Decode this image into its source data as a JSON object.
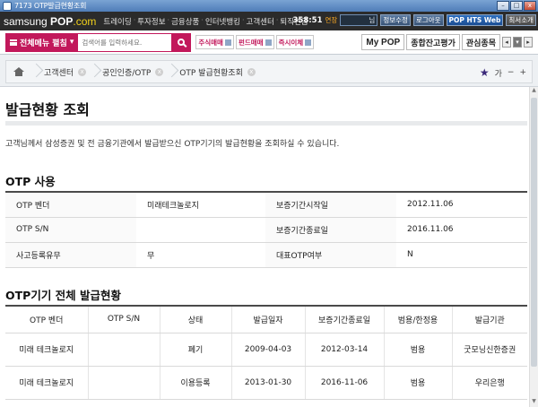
{
  "window": {
    "title": "7173 OTP발급현황조회",
    "min": "–",
    "max": "□",
    "close": "x"
  },
  "nav": {
    "logo_a": "samsung",
    "logo_b": "POP",
    "logo_c": ".com",
    "items": [
      "트레이딩",
      "투자정보",
      "금융상품",
      "인터넷뱅킹",
      "고객센터",
      "퇴직연금"
    ],
    "clock": "358:51",
    "clock_ext": "연장",
    "user_suffix": "님",
    "btn_info": "정보수정",
    "btn_logout": "로그아웃",
    "btn_hts": "POP HTS Web",
    "btn_min": "최서소개"
  },
  "bar2": {
    "allmenu": "전체메뉴 펼침",
    "search_placeholder": "검색어를 입력하세요.",
    "quick": [
      "주식매매",
      "펀드매매",
      "즉시이체"
    ],
    "right_tabs": [
      "My POP",
      "종합잔고평가",
      "관심종목"
    ],
    "mini": [
      "◂",
      "▾",
      "▸"
    ]
  },
  "breadcrumb": {
    "items": [
      "고객센터",
      "공인인증/OTP",
      "OTP 발급현황조회"
    ],
    "close": "x",
    "tools": {
      "star": "★",
      "font": "가",
      "minus": "−",
      "plus": "+"
    }
  },
  "page": {
    "title": "발급현황 조회",
    "description": "고객님께서 삼성증권 및 전 금융기관에서 발급받으신 OTP기기의 발급현황을 조회하실 수 있습니다."
  },
  "otp_use": {
    "heading": "OTP 사용",
    "rows": [
      [
        "OTP 벤더",
        "미래테크놀로지",
        "보증기간시작일",
        "2012.11.06"
      ],
      [
        "OTP S/N",
        "",
        "보증기간종료일",
        "2016.11.06"
      ],
      [
        "사고등록유무",
        "무",
        "대표OTP여부",
        "N"
      ]
    ]
  },
  "otp_all": {
    "heading": "OTP기기 전체 발급현황",
    "columns": [
      "OTP 벤더",
      "OTP S/N",
      "상태",
      "발급일자",
      "보증기간종료일",
      "범용/한정용",
      "발급기관"
    ],
    "rows": [
      [
        "미래 테크놀로지",
        "",
        "폐기",
        "2009-04-03",
        "2012-03-14",
        "범용",
        "굿모닝신한증권"
      ],
      [
        "미래 테크놀로지",
        "",
        "이용등록",
        "2013-01-30",
        "2016-11-06",
        "범용",
        "우리은행"
      ]
    ]
  },
  "scroll": {
    "up": "▲",
    "down": "▼"
  }
}
